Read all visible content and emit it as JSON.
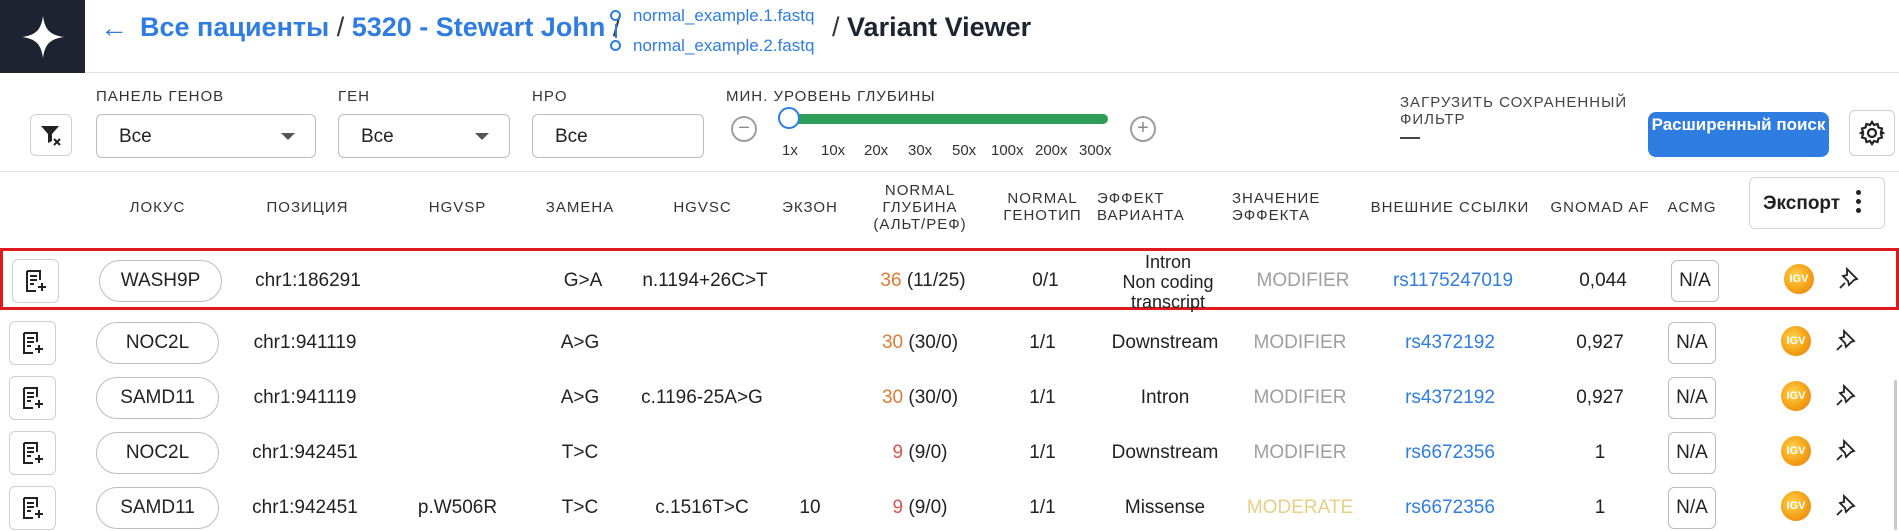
{
  "header": {
    "breadcrumb": {
      "all_patients": "Все пациенты",
      "sep1": "/",
      "patient": "5320 - Stewart John",
      "sep2": "/",
      "sep3": "/",
      "title": "Variant Viewer"
    },
    "files": [
      "normal_example.1.fastq",
      "normal_example.2.fastq"
    ]
  },
  "filters": {
    "gene_panel": {
      "label": "ПАНЕЛЬ ГЕНОВ",
      "value": "Все"
    },
    "gene": {
      "label": "ГЕН",
      "value": "Все"
    },
    "hpo": {
      "label": "HPO",
      "value": "Все"
    },
    "depth": {
      "label": "МИН. УРОВЕНЬ ГЛУБИНЫ",
      "ticks": [
        "1x",
        "10x",
        "20x",
        "30x",
        "50x",
        "100x",
        "200x",
        "300x"
      ],
      "selected": "1x",
      "minus": "−",
      "plus": "+"
    },
    "saved_filter": {
      "label": "ЗАГРУЗИТЬ СОХРАНЕННЫЙ ФИЛЬТР",
      "value": "—"
    },
    "advanced_search": "Расширенный поиск"
  },
  "table": {
    "columns": {
      "locus": "ЛОКУС",
      "position": "ПОЗИЦИЯ",
      "hgvsp": "HGVSP",
      "change": "ЗАМЕНА",
      "hgvsc": "HGVSC",
      "exon": "ЭКЗОН",
      "depth_1": "NORMAL",
      "depth_2": "ГЛУБИНА",
      "depth_3": "(АЛЬТ/РЕФ)",
      "genotype_1": "NORMAL",
      "genotype_2": "ГЕНОТИП",
      "effect_1": "ЭФФЕКТ",
      "effect_2": "ВАРИАНТА",
      "impact_1": "ЗНАЧЕНИЕ",
      "impact_2": "ЭФФЕКТА",
      "links": "ВНЕШНИЕ ССЫЛКИ",
      "gnomad": "GNOMAD AF",
      "acmg": "ACMG"
    },
    "export": "Экспорт",
    "rows": [
      {
        "locus": "WASH9P",
        "position": "chr1:186291",
        "hgvsp": "",
        "change": "G>A",
        "hgvsc": "n.1194+26C>T",
        "exon": "",
        "depth": "36",
        "altref": "(11/25)",
        "genotype": "0/1",
        "effect": [
          "Intron",
          "Non coding",
          "transcript"
        ],
        "impact": "MODIFIER",
        "link": "rs1175247019",
        "gnomad": "0,044",
        "acmg": "N/A",
        "igv": "IGV"
      },
      {
        "locus": "NOC2L",
        "position": "chr1:941119",
        "hgvsp": "",
        "change": "A>G",
        "hgvsc": "",
        "exon": "",
        "depth": "30",
        "altref": "(30/0)",
        "genotype": "1/1",
        "effect": [
          "Downstream"
        ],
        "impact": "MODIFIER",
        "link": "rs4372192",
        "gnomad": "0,927",
        "acmg": "N/A",
        "igv": "IGV"
      },
      {
        "locus": "SAMD11",
        "position": "chr1:941119",
        "hgvsp": "",
        "change": "A>G",
        "hgvsc": "c.1196-25A>G",
        "exon": "",
        "depth": "30",
        "altref": "(30/0)",
        "genotype": "1/1",
        "effect": [
          "Intron"
        ],
        "impact": "MODIFIER",
        "link": "rs4372192",
        "gnomad": "0,927",
        "acmg": "N/A",
        "igv": "IGV"
      },
      {
        "locus": "NOC2L",
        "position": "chr1:942451",
        "hgvsp": "",
        "change": "T>C",
        "hgvsc": "",
        "exon": "",
        "depth": "9",
        "altref": "(9/0)",
        "genotype": "1/1",
        "effect": [
          "Downstream"
        ],
        "impact": "MODIFIER",
        "link": "rs6672356",
        "gnomad": "1",
        "acmg": "N/A",
        "igv": "IGV"
      },
      {
        "locus": "SAMD11",
        "position": "chr1:942451",
        "hgvsp": "p.W506R",
        "change": "T>C",
        "hgvsc": "c.1516T>C",
        "exon": "10",
        "depth": "9",
        "altref": "(9/0)",
        "genotype": "1/1",
        "effect": [
          "Missense"
        ],
        "impact": "MODERATE",
        "link": "rs6672356",
        "gnomad": "1",
        "acmg": "N/A",
        "igv": "IGV"
      }
    ]
  },
  "colors": {
    "accent": "#2f7de1",
    "logo_bg": "#1d2330",
    "slider": "#2e9d57",
    "selection": "#e0191f",
    "modifier": "#9e9e9e",
    "moderate": "#e8cf86",
    "depth_high": "#e07b33",
    "depth_low": "#d9534f"
  }
}
